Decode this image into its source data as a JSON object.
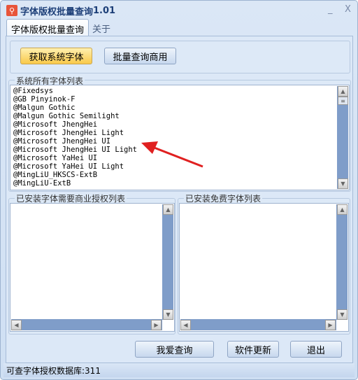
{
  "window": {
    "title": "字体版权批量查询",
    "version": "1.01",
    "minimize": "_",
    "close": "X"
  },
  "tabs": [
    {
      "label": "字体版权批量查询",
      "active": true
    },
    {
      "label": "关于",
      "active": false
    }
  ],
  "top_buttons": {
    "get_fonts": "获取系统字体",
    "batch_query": "批量查询商用"
  },
  "font_list": {
    "label": "系统所有字体列表",
    "items": [
      "@Fixedsys",
      "@GB Pinyinok-F",
      "@Malgun Gothic",
      "@Malgun Gothic Semilight",
      "@Microsoft JhengHei",
      "@Microsoft JhengHei Light",
      "@Microsoft JhengHei UI",
      "@Microsoft JhengHei UI Light",
      "@Microsoft YaHei UI",
      "@Microsoft YaHei UI Light",
      "@MingLiU_HKSCS-ExtB",
      "@MingLiU-ExtB"
    ]
  },
  "commercial_list": {
    "label": "已安装字体需要商业授权列表",
    "items": []
  },
  "free_list": {
    "label": "已安装免费字体列表",
    "items": []
  },
  "bottom_buttons": {
    "query": "我爱查询",
    "update": "软件更新",
    "exit": "退出"
  },
  "status": "可查字体授权数据库:311",
  "colors": {
    "accent_yellow": "#f9c94a",
    "arrow": "#e02020",
    "scrollbar": "#7f9dc9"
  }
}
